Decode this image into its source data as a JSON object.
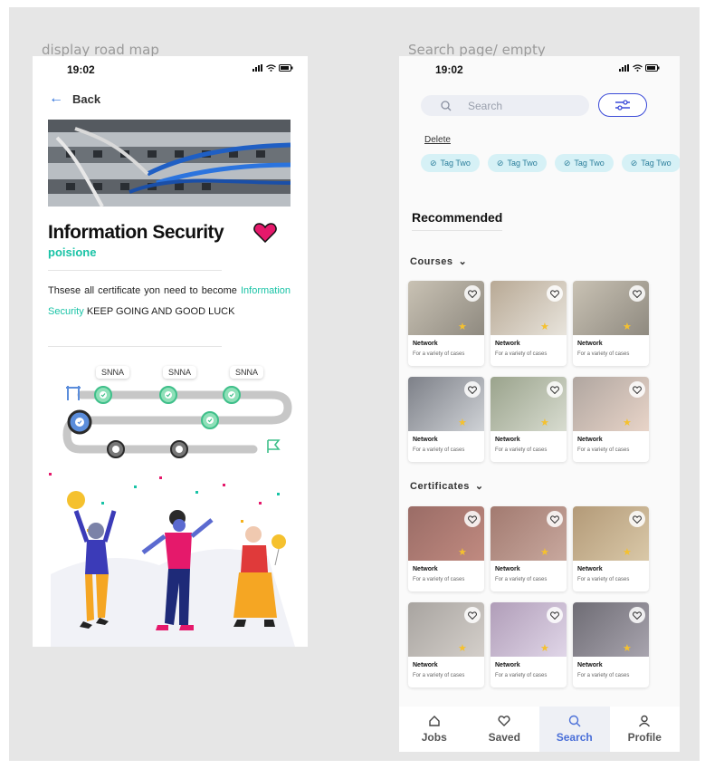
{
  "left": {
    "frame_label": "display road map",
    "time": "19:02",
    "back_label": "Back",
    "title": "Information Security",
    "subtitle": "poisione",
    "desc_part1": "Thsese all certificate yon need to become",
    "desc_highlight": "Information Security",
    "desc_part2": "KEEP GOING AND GOOD LUCK",
    "roadmap_labels": [
      "SNNA",
      "SNNA",
      "SNNA"
    ]
  },
  "right": {
    "frame_label": "Search page/ empty",
    "time": "19:02",
    "search_placeholder": "Search",
    "delete_label": "Delete",
    "tags": [
      "Tag Two",
      "Tag Two",
      "Tag Two",
      "Tag Two"
    ],
    "recommended_title": "Recommended",
    "courses_label": "Courses",
    "certificates_label": "Certificates",
    "card_title": "Network",
    "card_subtitle": "For a variety of cases",
    "nav": [
      {
        "label": "Jobs",
        "icon": "home-icon"
      },
      {
        "label": "Saved",
        "icon": "heart-icon"
      },
      {
        "label": "Search",
        "icon": "search-icon"
      },
      {
        "label": "Profile",
        "icon": "user-icon"
      }
    ]
  },
  "colors": {
    "accent_teal": "#19c3a6",
    "heart_pink": "#e5196b",
    "nav_active": "#4a6fd8",
    "tag_bg": "#d6f1f6"
  }
}
